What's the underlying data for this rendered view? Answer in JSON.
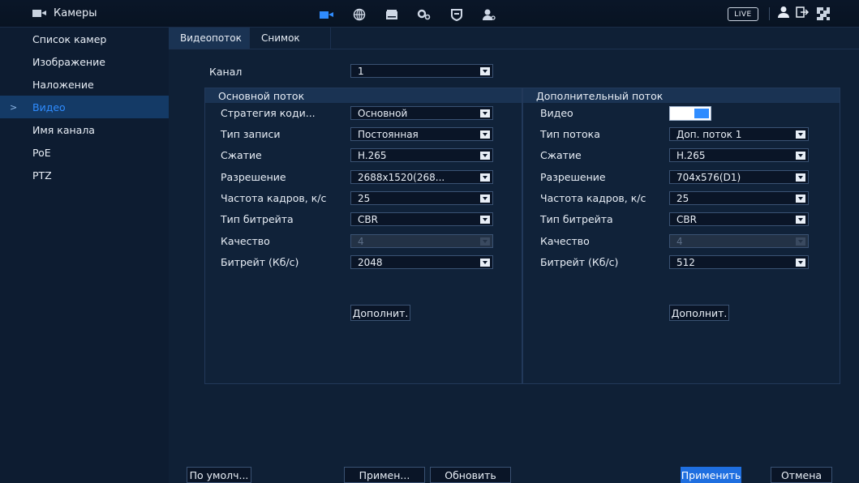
{
  "header": {
    "title": "Камеры",
    "nav_icons": [
      "camera-icon",
      "network-icon",
      "storage-icon",
      "settings-icon",
      "security-icon",
      "account-icon"
    ],
    "live_label": "LIVE",
    "right_icons": [
      "user-icon",
      "logout-icon",
      "qr-code-icon"
    ]
  },
  "sidebar": {
    "items": [
      {
        "label": "Список камер"
      },
      {
        "label": "Изображение"
      },
      {
        "label": "Наложение"
      },
      {
        "label": "Видео"
      },
      {
        "label": "Имя канала"
      },
      {
        "label": "PoE"
      },
      {
        "label": "PTZ"
      }
    ],
    "active_index": 3
  },
  "tabs": [
    {
      "label": "Видеопоток"
    },
    {
      "label": "Снимок"
    }
  ],
  "channel": {
    "label": "Канал",
    "value": "1"
  },
  "main_stream": {
    "title": "Основной поток",
    "rows": [
      {
        "label": "Стратегия коди...",
        "value": "Основной"
      },
      {
        "label": "Тип записи",
        "value": "Постоянная"
      },
      {
        "label": "Сжатие",
        "value": "H.265"
      },
      {
        "label": "Разрешение",
        "value": "2688x1520(268..."
      },
      {
        "label": "Частота кадров, к/с",
        "value": "25"
      },
      {
        "label": "Тип битрейта",
        "value": "CBR"
      },
      {
        "label": "Качество",
        "value": "4"
      },
      {
        "label": "Битрейт (Кб/с)",
        "value": "2048"
      }
    ],
    "more_button": "Дополнит."
  },
  "sub_stream": {
    "title": "Дополнительный поток",
    "video_label": "Видео",
    "video_enabled": true,
    "rows": [
      {
        "label": "Тип потока",
        "value": "Доп. поток 1"
      },
      {
        "label": "Сжатие",
        "value": "H.265"
      },
      {
        "label": "Разрешение",
        "value": "704x576(D1)"
      },
      {
        "label": "Частота кадров, к/с",
        "value": "25"
      },
      {
        "label": "Тип битрейта",
        "value": "CBR"
      },
      {
        "label": "Качество",
        "value": "4"
      },
      {
        "label": "Битрейт (Кб/с)",
        "value": "512"
      }
    ],
    "more_button": "Дополнит."
  },
  "footer": {
    "default_button": "По умолч...",
    "apply_short_button": "Примен...",
    "refresh_button": "Обновить",
    "apply_button": "Применить",
    "cancel_button": "Отмена"
  },
  "colors": {
    "accent": "#2f8cff",
    "background": "#0c1a2e",
    "primary_button": "#1f6fe0"
  }
}
